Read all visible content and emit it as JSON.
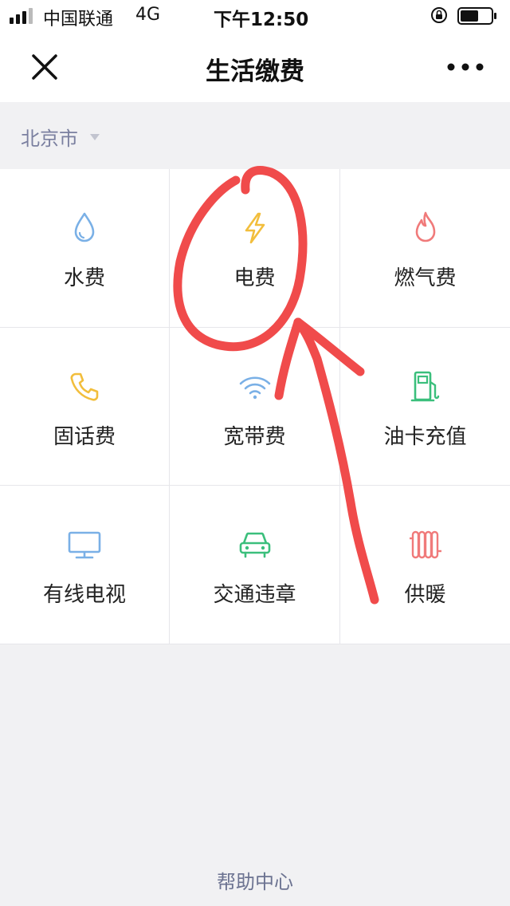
{
  "status_bar": {
    "carrier": "中国联通",
    "network": "4G",
    "time": "下午12:50"
  },
  "nav": {
    "title": "生活缴费",
    "close_icon": "close-icon",
    "more_icon": "more-icon"
  },
  "city": {
    "name": "北京市",
    "caret_icon": "caret-down-icon"
  },
  "services": [
    {
      "label": "水费",
      "icon": "water-drop-icon",
      "color": "#7ab0e6"
    },
    {
      "label": "电费",
      "icon": "lightning-icon",
      "color": "#f2be3c"
    },
    {
      "label": "燃气费",
      "icon": "flame-icon",
      "color": "#f07a7a"
    },
    {
      "label": "固话费",
      "icon": "phone-icon",
      "color": "#f2be3c"
    },
    {
      "label": "宽带费",
      "icon": "wifi-icon",
      "color": "#7ab0e6"
    },
    {
      "label": "油卡充值",
      "icon": "fuel-pump-icon",
      "color": "#3bbf7c"
    },
    {
      "label": "有线电视",
      "icon": "tv-icon",
      "color": "#7ab0e6"
    },
    {
      "label": "交通违章",
      "icon": "car-icon",
      "color": "#3bbf7c"
    },
    {
      "label": "供暖",
      "icon": "radiator-icon",
      "color": "#f07a7a"
    }
  ],
  "footer": {
    "help": "帮助中心"
  },
  "annotation": {
    "color": "#f04b4b",
    "marks": [
      "circle",
      "arrow"
    ]
  }
}
